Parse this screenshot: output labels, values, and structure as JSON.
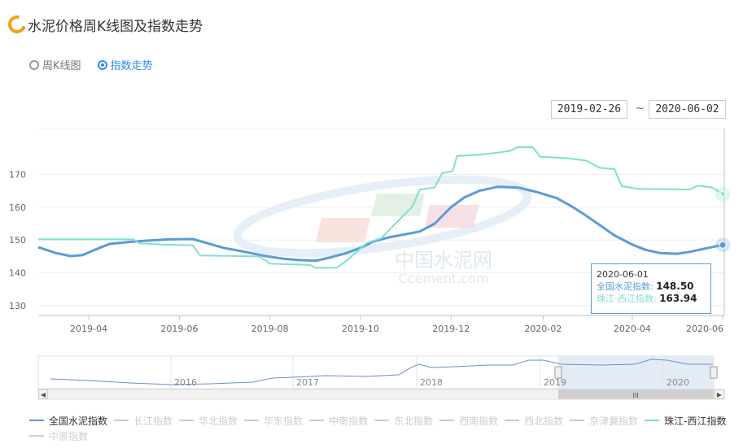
{
  "header": {
    "title": "水泥价格周K线图及指数走势"
  },
  "view_toggle": {
    "options": [
      "周K线图",
      "指数走势"
    ],
    "selected": "指数走势"
  },
  "range": {
    "start": "2019-02-26",
    "end": "2020-06-02",
    "separator": "~"
  },
  "tooltip": {
    "date": "2020-06-01",
    "series1_label": "全国水泥指数:",
    "series1_value": "148.50",
    "series2_label": "珠江-西江指数:",
    "series2_value": "163.94"
  },
  "watermark": {
    "text_cn": "中国水泥网",
    "text_en": "Ccement.com"
  },
  "navigator": {
    "year_labels": [
      "2016",
      "2017",
      "2018",
      "2019",
      "2020"
    ],
    "handle_label": "III"
  },
  "legend": [
    {
      "name": "全国水泥指数",
      "color": "#5b9bd5",
      "active": true
    },
    {
      "name": "长江指数",
      "color": "#cccccc",
      "active": false
    },
    {
      "name": "华北指数",
      "color": "#cccccc",
      "active": false
    },
    {
      "name": "华东指数",
      "color": "#cccccc",
      "active": false
    },
    {
      "name": "中南指数",
      "color": "#cccccc",
      "active": false
    },
    {
      "name": "东北指数",
      "color": "#cccccc",
      "active": false
    },
    {
      "name": "西南指数",
      "color": "#cccccc",
      "active": false
    },
    {
      "name": "西北指数",
      "color": "#cccccc",
      "active": false
    },
    {
      "name": "京津冀指数",
      "color": "#cccccc",
      "active": false
    },
    {
      "name": "珠江-西江指数",
      "color": "#7ee0cf",
      "active": true
    },
    {
      "name": "中原指数",
      "color": "#cccccc",
      "active": false
    }
  ],
  "chart_data": {
    "type": "line",
    "x_ticks": [
      "2019-04",
      "2019-06",
      "2019-08",
      "2019-10",
      "2019-12",
      "2020-02",
      "2020-04",
      "2020-06"
    ],
    "y_ticks": [
      130,
      140,
      150,
      160,
      170
    ],
    "ylim": [
      127,
      184
    ],
    "xlim": [
      "2019-02-26",
      "2020-06-02"
    ],
    "grid": true,
    "legend_position": "bottom",
    "series": [
      {
        "name": "全国水泥指数",
        "color": "#5b9bd5",
        "points": [
          [
            "2019-02-26",
            147.8
          ],
          [
            "2019-03-10",
            146.0
          ],
          [
            "2019-03-20",
            145.1
          ],
          [
            "2019-03-28",
            145.4
          ],
          [
            "2019-04-05",
            147.0
          ],
          [
            "2019-04-15",
            148.8
          ],
          [
            "2019-04-28",
            149.4
          ],
          [
            "2019-05-10",
            149.8
          ],
          [
            "2019-05-25",
            150.2
          ],
          [
            "2019-06-10",
            150.3
          ],
          [
            "2019-06-20",
            149.0
          ],
          [
            "2019-07-01",
            147.6
          ],
          [
            "2019-07-15",
            146.4
          ],
          [
            "2019-07-28",
            145.2
          ],
          [
            "2019-08-10",
            144.3
          ],
          [
            "2019-08-20",
            143.9
          ],
          [
            "2019-09-01",
            143.7
          ],
          [
            "2019-09-10",
            144.6
          ],
          [
            "2019-09-20",
            145.8
          ],
          [
            "2019-10-01",
            147.6
          ],
          [
            "2019-10-10",
            149.6
          ],
          [
            "2019-10-20",
            150.8
          ],
          [
            "2019-11-01",
            151.8
          ],
          [
            "2019-11-10",
            152.6
          ],
          [
            "2019-11-20",
            155.0
          ],
          [
            "2019-12-01",
            160.0
          ],
          [
            "2019-12-10",
            163.0
          ],
          [
            "2019-12-20",
            165.0
          ],
          [
            "2020-01-01",
            166.2
          ],
          [
            "2020-01-15",
            166.0
          ],
          [
            "2020-01-28",
            164.6
          ],
          [
            "2020-02-10",
            162.8
          ],
          [
            "2020-02-20",
            160.3
          ],
          [
            "2020-03-01",
            157.4
          ],
          [
            "2020-03-10",
            154.6
          ],
          [
            "2020-03-20",
            151.4
          ],
          [
            "2020-04-01",
            148.6
          ],
          [
            "2020-04-10",
            147.0
          ],
          [
            "2020-04-20",
            146.0
          ],
          [
            "2020-05-01",
            145.8
          ],
          [
            "2020-05-10",
            146.4
          ],
          [
            "2020-05-20",
            147.4
          ],
          [
            "2020-06-01",
            148.5
          ]
        ]
      },
      {
        "name": "珠江-西江指数",
        "color": "#7ee0cf",
        "points": [
          [
            "2019-02-26",
            150.2
          ],
          [
            "2019-05-01",
            150.2
          ],
          [
            "2019-05-05",
            149.0
          ],
          [
            "2019-05-20",
            148.6
          ],
          [
            "2019-06-10",
            148.4
          ],
          [
            "2019-06-15",
            145.3
          ],
          [
            "2019-07-25",
            145.0
          ],
          [
            "2019-08-01",
            142.8
          ],
          [
            "2019-08-28",
            142.4
          ],
          [
            "2019-09-01",
            141.5
          ],
          [
            "2019-09-15",
            141.6
          ],
          [
            "2019-09-22",
            143.8
          ],
          [
            "2019-10-05",
            149.0
          ],
          [
            "2019-10-15",
            150.6
          ],
          [
            "2019-10-25",
            155.2
          ],
          [
            "2019-11-05",
            160.2
          ],
          [
            "2019-11-10",
            165.4
          ],
          [
            "2019-11-20",
            166.0
          ],
          [
            "2019-11-25",
            170.4
          ],
          [
            "2019-12-02",
            171.0
          ],
          [
            "2019-12-05",
            175.6
          ],
          [
            "2019-12-20",
            176.0
          ],
          [
            "2020-01-01",
            176.6
          ],
          [
            "2020-01-10",
            177.2
          ],
          [
            "2020-01-15",
            178.3
          ],
          [
            "2020-01-25",
            178.3
          ],
          [
            "2020-01-30",
            175.4
          ],
          [
            "2020-02-15",
            175.0
          ],
          [
            "2020-03-01",
            174.2
          ],
          [
            "2020-03-10",
            172.0
          ],
          [
            "2020-03-20",
            171.6
          ],
          [
            "2020-03-25",
            166.4
          ],
          [
            "2020-04-05",
            165.6
          ],
          [
            "2020-05-10",
            165.4
          ],
          [
            "2020-05-15",
            166.6
          ],
          [
            "2020-05-25",
            166.0
          ],
          [
            "2020-06-01",
            163.94
          ]
        ]
      }
    ]
  }
}
